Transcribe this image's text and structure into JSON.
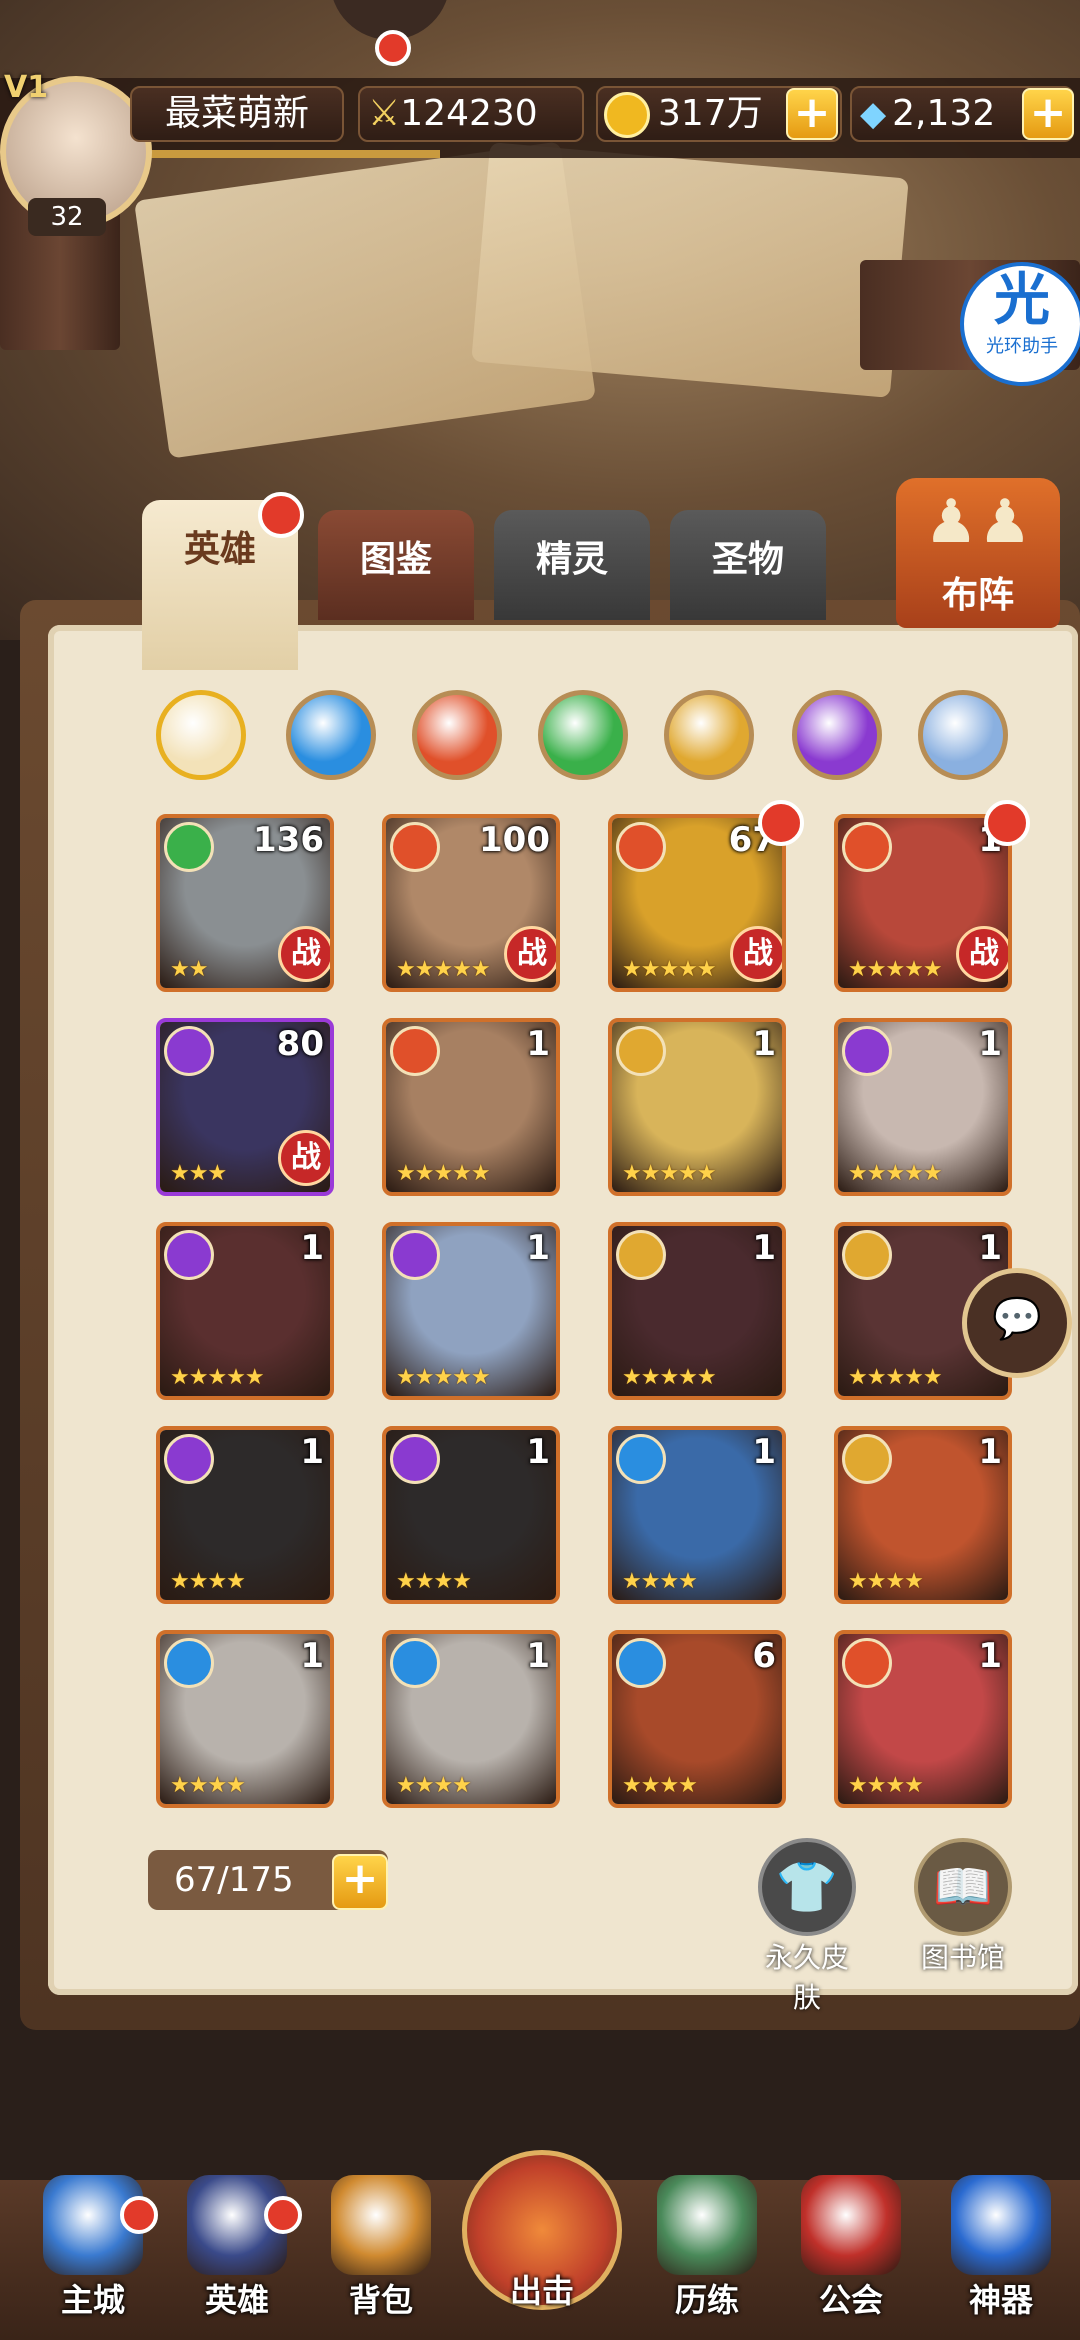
{
  "player": {
    "vip": "V1",
    "level": "32",
    "name": "最菜萌新",
    "power": "124230"
  },
  "currency": {
    "gold": "317万",
    "gems": "2,132"
  },
  "assistant": {
    "badge": "光",
    "label": "光环助手"
  },
  "tabs": [
    {
      "label": "英雄",
      "active": true
    },
    {
      "label": "图鉴",
      "active": false
    },
    {
      "label": "精灵",
      "active": false
    },
    {
      "label": "圣物",
      "active": false
    }
  ],
  "formation_label": "布阵",
  "element_filters": [
    "all-icon",
    "water-icon",
    "fire-icon",
    "wind-icon",
    "light-icon",
    "dark-icon",
    "void-icon"
  ],
  "heroes": [
    {
      "level": "136",
      "element": "wind",
      "stars": "★★",
      "battle": "战",
      "dot": false,
      "tone": "#8a8f92"
    },
    {
      "level": "100",
      "element": "fire",
      "stars": "★★★★★",
      "battle": "战",
      "dot": false,
      "tone": "#b08868"
    },
    {
      "level": "67",
      "element": "fire",
      "stars": "★★★★★",
      "battle": "战",
      "dot": true,
      "tone": "#d9a12a"
    },
    {
      "level": "1",
      "element": "fire",
      "stars": "★★★★★",
      "battle": "战",
      "dot": true,
      "tone": "#b8483a"
    },
    {
      "level": "80",
      "element": "dark",
      "stars": "★★★",
      "battle": "战",
      "dot": false,
      "tone": "#3a3560"
    },
    {
      "level": "1",
      "element": "fire",
      "stars": "★★★★★",
      "battle": "",
      "dot": false,
      "tone": "#a78062"
    },
    {
      "level": "1",
      "element": "light",
      "stars": "★★★★★",
      "battle": "",
      "dot": false,
      "tone": "#d8b45a"
    },
    {
      "level": "1",
      "element": "dark",
      "stars": "★★★★★",
      "battle": "",
      "dot": false,
      "tone": "#c8b8b0"
    },
    {
      "level": "1",
      "element": "dark",
      "stars": "★★★★★",
      "battle": "",
      "dot": false,
      "tone": "#5a2f2f"
    },
    {
      "level": "1",
      "element": "dark",
      "stars": "★★★★★",
      "battle": "",
      "dot": false,
      "tone": "#8fa2c0"
    },
    {
      "level": "1",
      "element": "light",
      "stars": "★★★★★",
      "battle": "",
      "dot": false,
      "tone": "#4a2a2e"
    },
    {
      "level": "1",
      "element": "light",
      "stars": "★★★★★",
      "battle": "",
      "dot": false,
      "tone": "#5a3434"
    },
    {
      "level": "1",
      "element": "dark",
      "stars": "★★★★",
      "battle": "",
      "dot": false,
      "tone": "#2d2a2a"
    },
    {
      "level": "1",
      "element": "dark",
      "stars": "★★★★",
      "battle": "",
      "dot": false,
      "tone": "#2d2a2a"
    },
    {
      "level": "1",
      "element": "water",
      "stars": "★★★★",
      "battle": "",
      "dot": false,
      "tone": "#3a6aa8"
    },
    {
      "level": "1",
      "element": "light",
      "stars": "★★★★",
      "battle": "",
      "dot": false,
      "tone": "#c0542e"
    },
    {
      "level": "1",
      "element": "water",
      "stars": "★★★★",
      "battle": "",
      "dot": false,
      "tone": "#b8b2ac"
    },
    {
      "level": "1",
      "element": "water",
      "stars": "★★★★",
      "battle": "",
      "dot": false,
      "tone": "#b8b2ac"
    },
    {
      "level": "6",
      "element": "water",
      "stars": "★★★★",
      "battle": "",
      "dot": false,
      "tone": "#a84a2a"
    },
    {
      "level": "1",
      "element": "fire",
      "stars": "★★★★",
      "battle": "",
      "dot": false,
      "tone": "#c24848"
    }
  ],
  "capacity": "67/175",
  "actions": {
    "skins": "永久皮肤",
    "library": "图书馆"
  },
  "nav": [
    {
      "label": "主城",
      "dot": true
    },
    {
      "label": "英雄",
      "dot": true
    },
    {
      "label": "背包",
      "dot": false
    },
    {
      "label": "出击",
      "dot": false
    },
    {
      "label": "历练",
      "dot": false
    },
    {
      "label": "公会",
      "dot": false
    },
    {
      "label": "神器",
      "dot": false
    }
  ],
  "colors": {
    "water": "#2a8ee0",
    "fire": "#e0502a",
    "wind": "#3ab04a",
    "light": "#e0a830",
    "dark": "#8a3ad0",
    "void": "#8ab0e0"
  }
}
